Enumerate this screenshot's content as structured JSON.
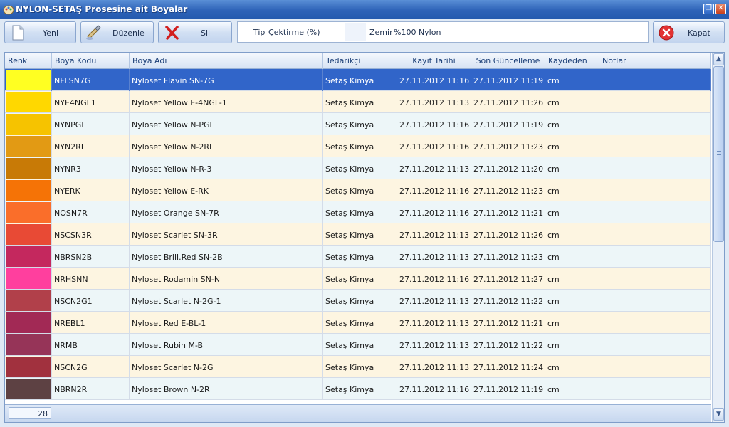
{
  "window": {
    "title": "NYLON-SETAŞ Prosesine ait Boyalar"
  },
  "toolbar": {
    "new_label": "Yeni",
    "edit_label": "Düzenle",
    "delete_label": "Sil",
    "close_label": "Kapat"
  },
  "filter": {
    "type_label": "Tipi",
    "type_value": "Çektirme (%)",
    "base_label": "Zemin",
    "base_value": "%100 Nylon"
  },
  "grid": {
    "columns": [
      "Renk",
      "Boya Kodu",
      "Boya Adı",
      "Tedarikçi",
      "Kayıt Tarihi",
      "Son Güncelleme",
      "Kaydeden",
      "Notlar"
    ],
    "rows": [
      {
        "color": "#ffff22",
        "code": "NFLSN7G",
        "name": "Nyloset Flavin SN-7G",
        "supplier": "Setaş Kimya",
        "created": "27.11.2012 11:16",
        "updated": "27.11.2012 11:19",
        "by": "cm",
        "notes": ""
      },
      {
        "color": "#ffd800",
        "code": "NYE4NGL1",
        "name": "Nyloset Yellow E-4NGL-1",
        "supplier": "Setaş Kimya",
        "created": "27.11.2012 11:13",
        "updated": "27.11.2012 11:26",
        "by": "cm",
        "notes": ""
      },
      {
        "color": "#f6c300",
        "code": "NYNPGL",
        "name": "Nyloset Yellow N-PGL",
        "supplier": "Setaş Kimya",
        "created": "27.11.2012 11:16",
        "updated": "27.11.2012 11:19",
        "by": "cm",
        "notes": ""
      },
      {
        "color": "#e29a14",
        "code": "NYN2RL",
        "name": "Nyloset Yellow N-2RL",
        "supplier": "Setaş Kimya",
        "created": "27.11.2012 11:16",
        "updated": "27.11.2012 11:23",
        "by": "cm",
        "notes": ""
      },
      {
        "color": "#c87a06",
        "code": "NYNR3",
        "name": "Nyloset Yellow N-R-3",
        "supplier": "Setaş Kimya",
        "created": "27.11.2012 11:13",
        "updated": "27.11.2012 11:20",
        "by": "cm",
        "notes": ""
      },
      {
        "color": "#f57306",
        "code": "NYERK",
        "name": "Nyloset Yellow E-RK",
        "supplier": "Setaş Kimya",
        "created": "27.11.2012 11:16",
        "updated": "27.11.2012 11:23",
        "by": "cm",
        "notes": ""
      },
      {
        "color": "#fa6e2a",
        "code": "NOSN7R",
        "name": "Nyloset Orange SN-7R",
        "supplier": "Setaş Kimya",
        "created": "27.11.2012 11:16",
        "updated": "27.11.2012 11:21",
        "by": "cm",
        "notes": ""
      },
      {
        "color": "#e84a35",
        "code": "NSCSN3R",
        "name": "Nyloset Scarlet SN-3R",
        "supplier": "Setaş Kimya",
        "created": "27.11.2012 11:13",
        "updated": "27.11.2012 11:26",
        "by": "cm",
        "notes": ""
      },
      {
        "color": "#c4285e",
        "code": "NBRSN2B",
        "name": "Nyloset Brill.Red SN-2B",
        "supplier": "Setaş Kimya",
        "created": "27.11.2012 11:13",
        "updated": "27.11.2012 11:23",
        "by": "cm",
        "notes": ""
      },
      {
        "color": "#ff3f9e",
        "code": "NRHSNN",
        "name": "Nyloset Rodamin SN-N",
        "supplier": "Setaş Kimya",
        "created": "27.11.2012 11:16",
        "updated": "27.11.2012 11:27",
        "by": "cm",
        "notes": ""
      },
      {
        "color": "#b1404a",
        "code": "NSCN2G1",
        "name": "Nyloset Scarlet N-2G-1",
        "supplier": "Setaş Kimya",
        "created": "27.11.2012 11:13",
        "updated": "27.11.2012 11:22",
        "by": "cm",
        "notes": ""
      },
      {
        "color": "#a22955",
        "code": "NREBL1",
        "name": "Nyloset Red E-BL-1",
        "supplier": "Setaş Kimya",
        "created": "27.11.2012 11:13",
        "updated": "27.11.2012 11:21",
        "by": "cm",
        "notes": ""
      },
      {
        "color": "#963458",
        "code": "NRMB",
        "name": "Nyloset Rubin M-B",
        "supplier": "Setaş Kimya",
        "created": "27.11.2012 11:13",
        "updated": "27.11.2012 11:22",
        "by": "cm",
        "notes": ""
      },
      {
        "color": "#a1313e",
        "code": "NSCN2G",
        "name": "Nyloset Scarlet N-2G",
        "supplier": "Setaş Kimya",
        "created": "27.11.2012 11:13",
        "updated": "27.11.2012 11:24",
        "by": "cm",
        "notes": ""
      },
      {
        "color": "#5d4143",
        "code": "NBRN2R",
        "name": "Nyloset Brown N-2R",
        "supplier": "Setaş Kimya",
        "created": "27.11.2012 11:16",
        "updated": "27.11.2012 11:19",
        "by": "cm",
        "notes": ""
      }
    ],
    "selected_row_index": 0
  },
  "footer": {
    "record_count": "28"
  },
  "icons": {
    "app": "paint-palette-icon",
    "new": "blank-document-icon",
    "edit": "paint-brush-icon",
    "delete": "red-x-icon",
    "close": "red-circle-x-icon"
  }
}
